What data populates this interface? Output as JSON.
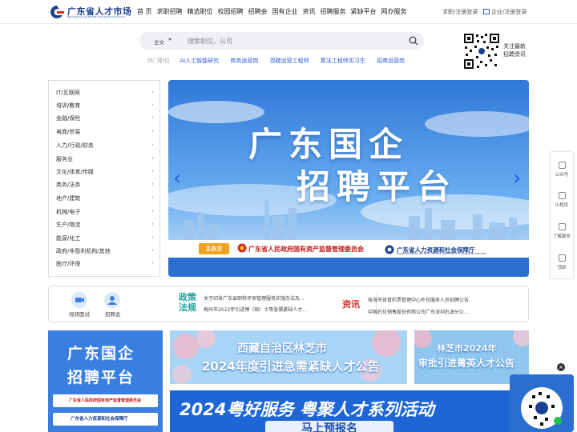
{
  "header": {
    "logo_text": "广东省人才市场",
    "logo_sub": "Talent Resources Market of Guangdong Province",
    "nav": [
      "首 页",
      "求职招聘",
      "精选职位",
      "校园招聘",
      "招聘会",
      "国有企业",
      "资讯",
      "招聘服务",
      "紧缺平台",
      "网办服务"
    ],
    "login": "求职/注册登录",
    "corp_login": "企业/注册登录"
  },
  "search": {
    "scope": "全文",
    "placeholder": "搜索职位，公司"
  },
  "hot": {
    "label": "热门职位",
    "items": [
      "AI人工智能研究",
      "商务运营岗",
      "双碳运营工程师",
      "算法工程师实习生",
      "招商运营岗"
    ]
  },
  "qr": {
    "line1": "关注最新",
    "line2": "招聘资讯"
  },
  "categories": [
    "IT/互联网",
    "培训/教育",
    "金融/保险",
    "电商/贸易",
    "人力/行政/财务",
    "服务业",
    "文化/体育/传媒",
    "商务/法务",
    "地产/建筑",
    "机械/电子",
    "生产/物流",
    "能源/化工",
    "政府/非盈利机构/其他",
    "医疗/环保"
  ],
  "banner": {
    "title_line1": "广东国企",
    "title_line2": "招聘平台",
    "host_tag": "主办方",
    "host1": "广东省人民政府国有资产监督管理委员会",
    "host2": "广东省人力资源和社会保障厅",
    "host2_sub": "HUMAN RESOURCES AND SOCIAL SECURITY DEPARTMENT OF GUANGDONG PROVINCE"
  },
  "quick": {
    "video_label": "视频面试",
    "fair_label": "招聘会",
    "policy_h1": "政策",
    "policy_h2": "法规",
    "policy_items": [
      "关于印发广东省职称评审管理服务实施办法及...",
      "梅州市2022年引进博（硕）士等急需紧缺人才..."
    ],
    "news_h": "资讯",
    "news_items": [
      "珠海市体育彩票管理中心外包服务人员招聘公告",
      "中国石化销售股份有限公司广东深圳石油分公..."
    ]
  },
  "sidebar": {
    "items": [
      "公众号",
      "小程序",
      "了解服务",
      "顶部"
    ]
  },
  "promos": {
    "p1_t1": "广东国企",
    "p1_t2": "招聘平台",
    "p1_b1": "广东省人民政府国有资产监督管理委员会",
    "p1_b2": "广东省人力资源和社会保障厅",
    "p2_t1": "西藏自治区林芝市",
    "p2_t2": "2024年度引进急需紧缺人才公告",
    "p3_t1": "林芝市2024年",
    "p3_t2": "审批引进菁英人才公告",
    "p4_title": "2024粤好服务 粤聚人才系列活动",
    "p4_btn": "马上预报名"
  },
  "float": {
    "close": "×"
  },
  "colors": {
    "brand_blue": "#1b3f8f",
    "accent_blue": "#2a5bd7",
    "red": "#c71a1a",
    "orange": "#f0a21e"
  }
}
